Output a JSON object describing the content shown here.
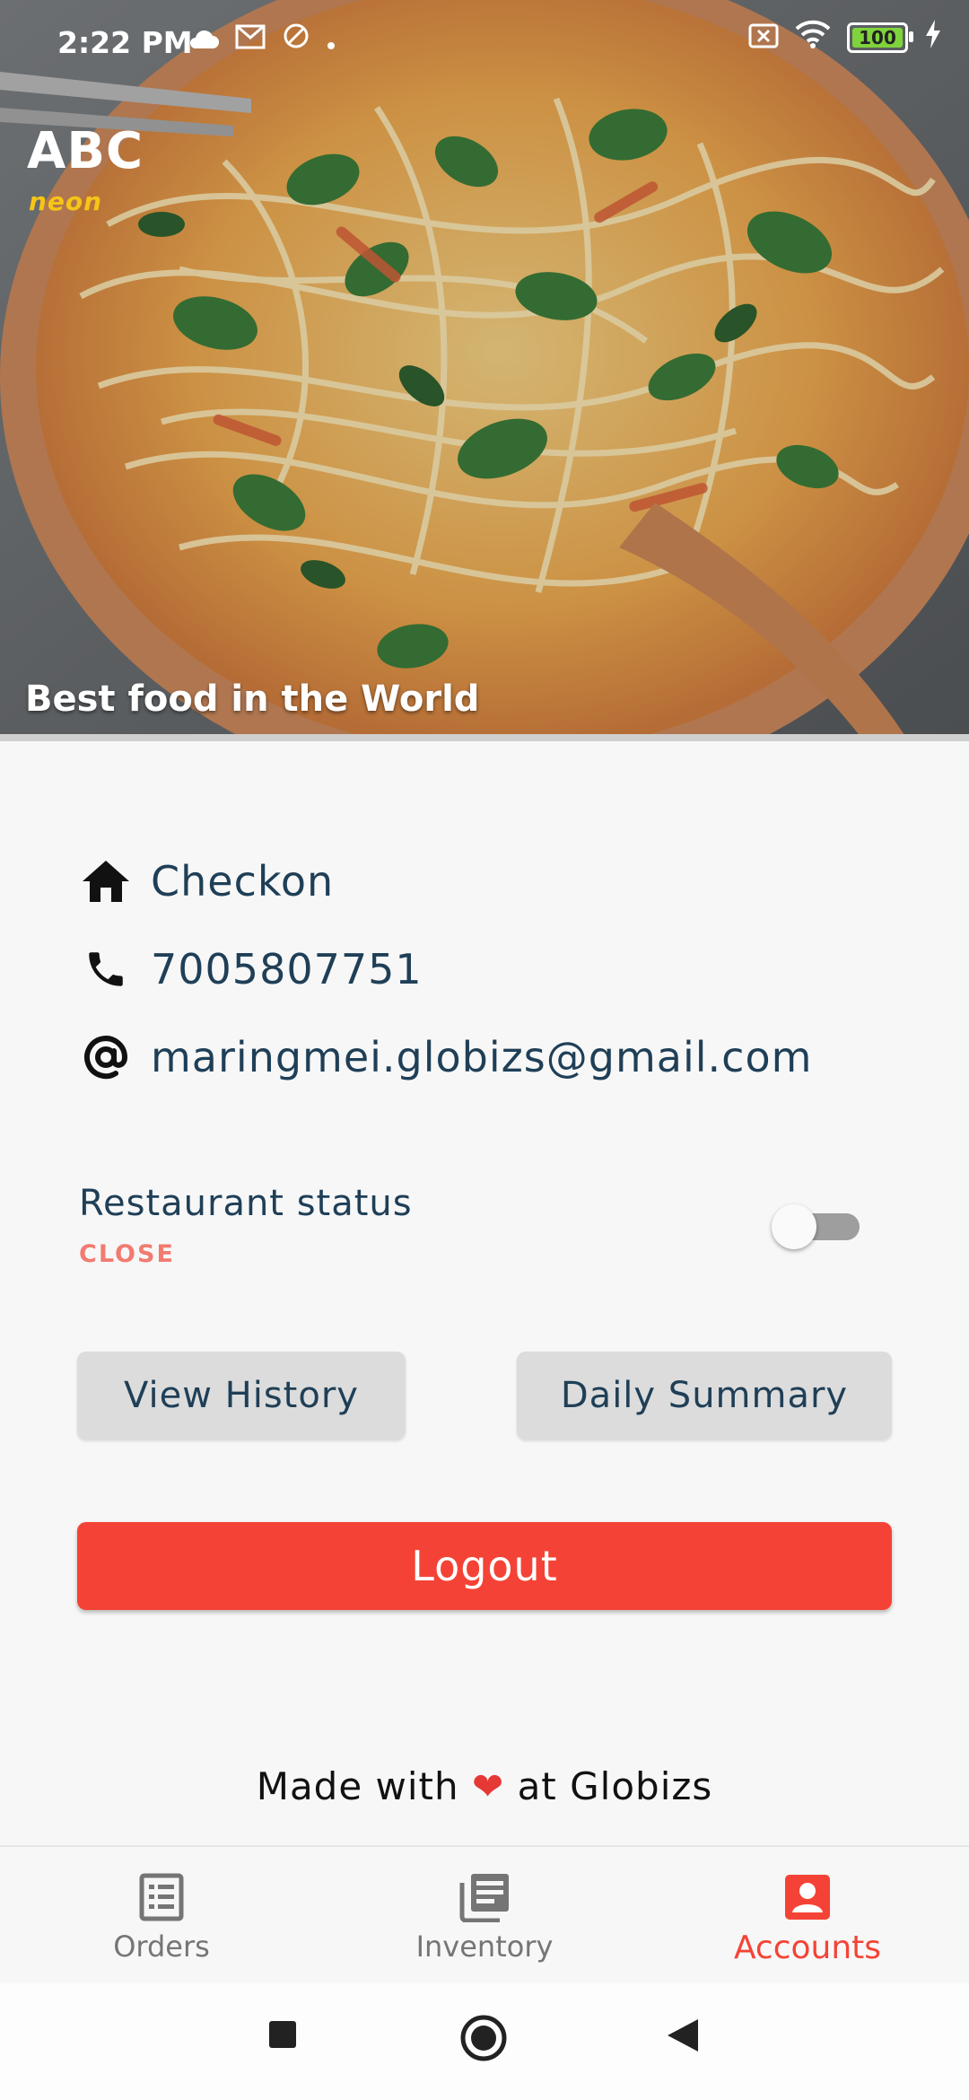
{
  "status_bar": {
    "time": "2:22 PM",
    "battery": "100",
    "icons_left": [
      "cloud-icon",
      "gmail-icon",
      "no-sync-icon",
      "dot-icon"
    ],
    "icons_right": [
      "no-sim-icon",
      "wifi-icon",
      "battery-icon",
      "charging-icon"
    ]
  },
  "hero": {
    "brand": "ABC",
    "logo_text": "neon",
    "tagline": "Best food in the World"
  },
  "restaurant": {
    "name": "Checkon",
    "phone": "7005807751",
    "email": "maringmei.globizs@gmail.com"
  },
  "status": {
    "label": "Restaurant status",
    "value": "CLOSE",
    "toggle_on": false
  },
  "buttons": {
    "history": "View History",
    "summary": "Daily Summary",
    "logout": "Logout"
  },
  "footer": {
    "made_prefix": "Made with",
    "heart": "❤",
    "made_suffix": "at Globizs"
  },
  "bottom_nav": {
    "orders": "Orders",
    "inventory": "Inventory",
    "accounts": "Accounts",
    "active": "Accounts"
  },
  "colors": {
    "accent": "#f44336",
    "text_dark": "#1f3f57",
    "status_close": "#f27b70",
    "button_grey": "#dcdcdc"
  }
}
